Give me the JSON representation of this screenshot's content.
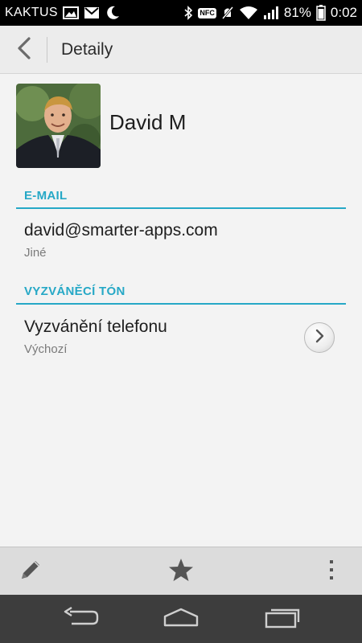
{
  "status_bar": {
    "carrier": "KAKTUS",
    "nfc_label": "NFC",
    "battery_percent": "81%",
    "time": "0:02",
    "icons": [
      "image-icon",
      "mail-icon",
      "moon-icon",
      "bluetooth-icon",
      "nfc-icon",
      "mute-icon",
      "wifi-icon",
      "signal-icon",
      "battery-icon"
    ]
  },
  "action_bar": {
    "title": "Detaily",
    "back_icon": "chevron-left-icon"
  },
  "contact": {
    "name": "David M"
  },
  "sections": {
    "email_header": "E-MAIL",
    "email_value": "david@smarter-apps.com",
    "email_type": "Jiné",
    "ringtone_header": "VYZVÁNĚCÍ TÓN",
    "ringtone_title": "Vyzvánění telefonu",
    "ringtone_value": "Výchozí"
  },
  "toolbar": {
    "icons": [
      "pencil-icon",
      "star-icon",
      "more-vertical-icon"
    ]
  },
  "nav_bar": {
    "icons": [
      "back-icon",
      "home-icon",
      "recents-icon"
    ]
  },
  "colors": {
    "accent": "#26a8c6",
    "action_bar": "#ececec",
    "toolbar": "#dcdcdc",
    "nav_bar": "#3d3d3d"
  }
}
